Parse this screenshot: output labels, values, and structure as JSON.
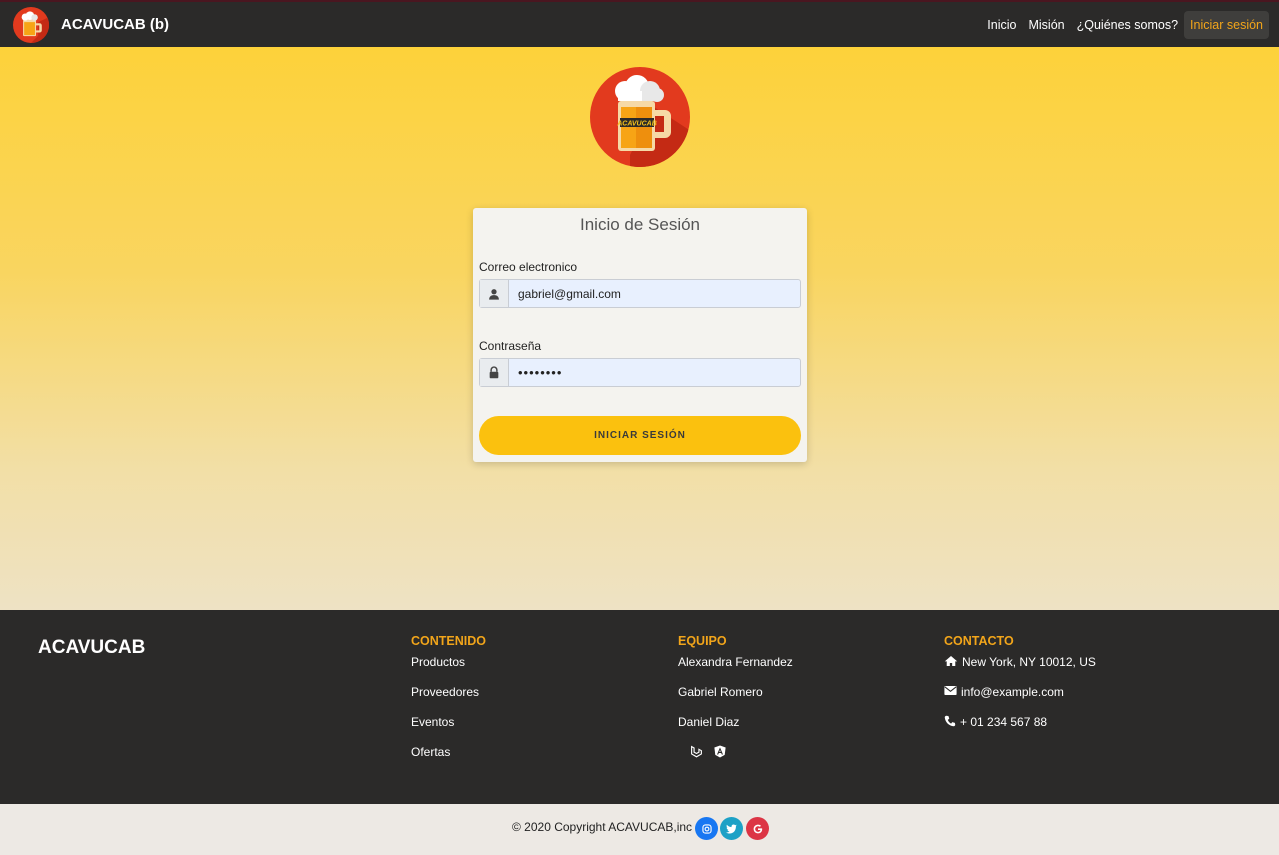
{
  "navbar": {
    "brand": "ACAVUCAB (b)",
    "links": [
      "Inicio",
      "Misión",
      "¿Quiénes somos?"
    ],
    "active_link": "Iniciar sesión"
  },
  "logo_text": "ACAVUCAB",
  "login": {
    "title": "Inicio de Sesión",
    "email_label": "Correo electronico",
    "email_value": "gabriel@gmail.com",
    "password_label": "Contraseña",
    "password_value": "••••••••",
    "submit_label": "INICIAR SESIÓN"
  },
  "footer": {
    "brand": "ACAVUCAB",
    "contenido": {
      "heading": "CONTENIDO",
      "items": [
        "Productos",
        "Proveedores",
        "Eventos",
        "Ofertas"
      ]
    },
    "equipo": {
      "heading": "EQUIPO",
      "items": [
        "Alexandra Fernandez",
        "Gabriel Romero",
        "Daniel Diaz"
      ],
      "icons": [
        "laravel-icon",
        "angular-icon"
      ]
    },
    "contacto": {
      "heading": "CONTACTO",
      "address": "New York, NY 10012, US",
      "email": "info@example.com",
      "phone": "+ 01 234 567 88"
    },
    "copyright": "© 2020 Copyright ACAVUCAB,inc",
    "social": [
      {
        "name": "instagram-icon",
        "color": "#1877f2"
      },
      {
        "name": "twitter-icon",
        "color": "#1da1c6"
      },
      {
        "name": "google-icon",
        "color": "#dc3545"
      }
    ]
  },
  "colors": {
    "navbar_bg": "#2b2a29",
    "accent": "#f2a51a",
    "button": "#fbc10e"
  }
}
